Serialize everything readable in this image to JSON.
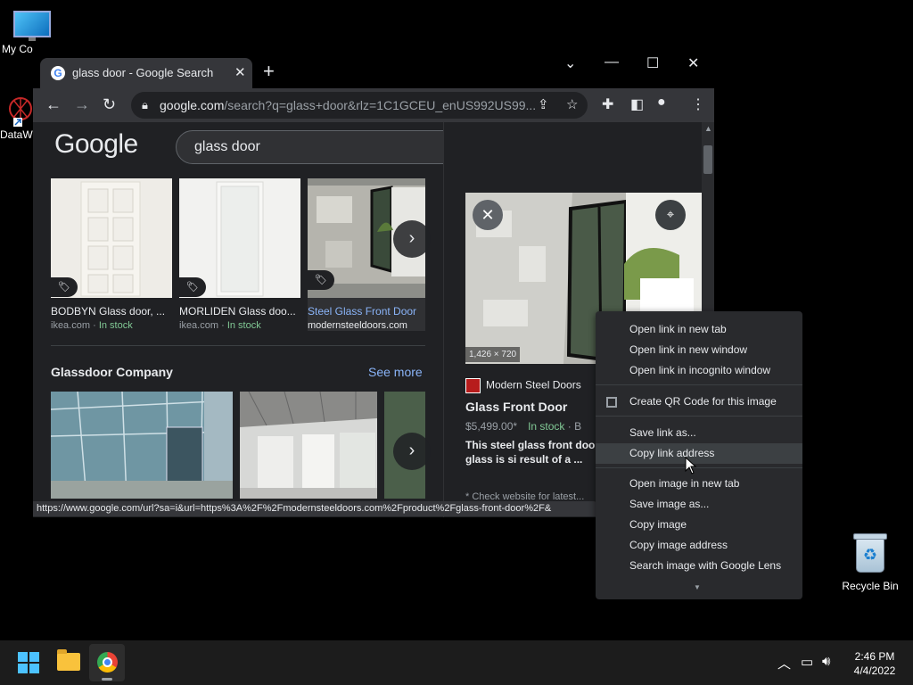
{
  "desktop": {
    "icons": [
      {
        "label": "My Co"
      },
      {
        "label": "DataW"
      },
      {
        "label": "Recycle Bin"
      }
    ]
  },
  "browser": {
    "tab_title": "glass door - Google Search",
    "tab_close": "✕",
    "new_tab": "+",
    "window_controls": {
      "tabsearch": "⌄",
      "minimize": "—",
      "maximize": "☐",
      "close": "✕"
    },
    "url_host": "google.com",
    "url_path": "/search?q=glass+door&rlz=1C1GCEU_enUS992US99...",
    "status_url": "https://www.google.com/url?sa=i&url=https%3A%2F%2Fmodernsteeldoors.com%2Fproduct%2Fglass-front-door%2F&"
  },
  "google": {
    "logo": "Google",
    "query": "glass door",
    "results": [
      {
        "title": "BODBYN Glass door, ...",
        "source": "ikea.com",
        "stock": "In stock"
      },
      {
        "title": "MORLIDEN Glass doo...",
        "source": "ikea.com",
        "stock": "In stock"
      },
      {
        "title": "Steel Glass Front Door",
        "source": "modernsteeldoors.com",
        "stock": ""
      }
    ],
    "section_title": "Glassdoor Company",
    "see_more": "See more"
  },
  "panel": {
    "dimensions": "1,426 × 720",
    "source": "Modern Steel Doors",
    "title": "Glass Front Door",
    "price": "$5,499.00*",
    "stock": "In stock",
    "stock_suffix": "· B",
    "description": "This steel glass front door metal door with glass is si result of a ...",
    "more": "* Check website for latest..."
  },
  "context_menu": {
    "items": [
      "Open link in new tab",
      "Open link in new window",
      "Open link in incognito window",
      "Create QR Code for this image",
      "Save link as...",
      "Copy link address",
      "Open image in new tab",
      "Save image as...",
      "Copy image",
      "Copy image address",
      "Search image with Google Lens"
    ],
    "highlighted": "Copy link address"
  },
  "taskbar": {
    "time": "2:46 PM",
    "date": "4/4/2022"
  },
  "colors": {
    "accent_blue": "#8ab4f8",
    "in_stock_green": "#81c995",
    "menu_bg": "#292a2d"
  }
}
